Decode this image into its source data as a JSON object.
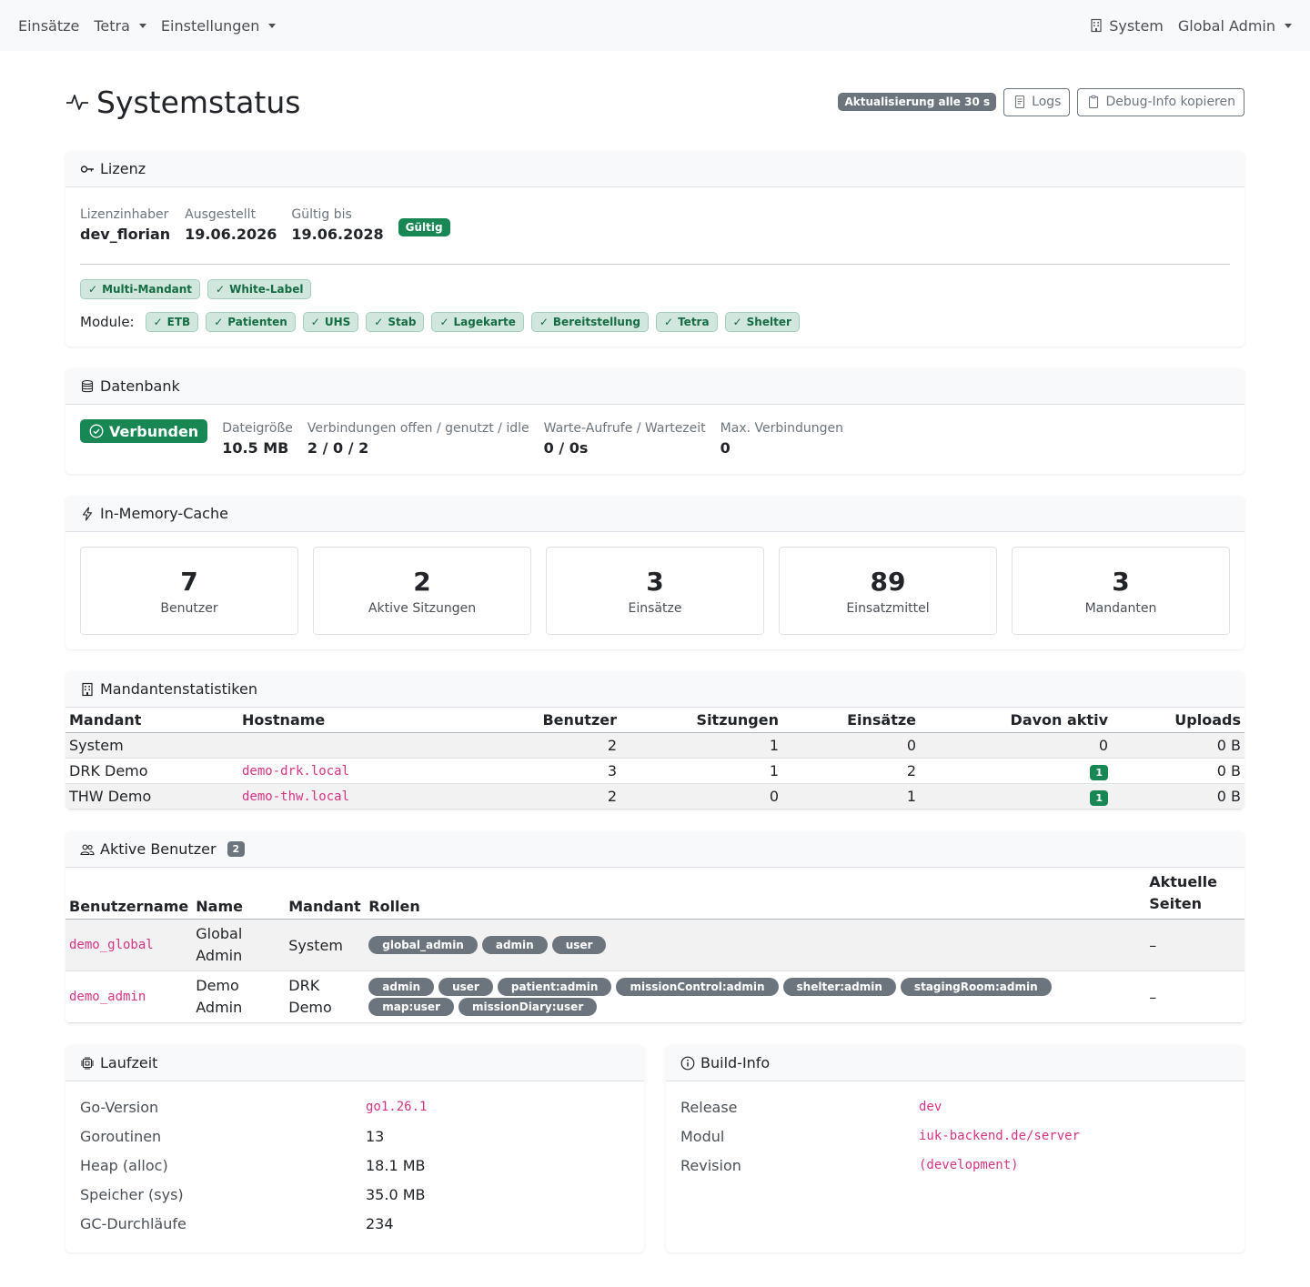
{
  "nav": {
    "left": [
      "Einsätze",
      "Tetra",
      "Einstellungen"
    ],
    "system": "System",
    "user": "Global Admin"
  },
  "header": {
    "title": "Systemstatus",
    "refresh_badge": "Aktualisierung alle 30 s",
    "logs_button": "Logs",
    "debug_button": "Debug-Info kopieren"
  },
  "license": {
    "title": "Lizenz",
    "holder_label": "Lizenzinhaber",
    "holder": "dev_florian",
    "issued_label": "Ausgestellt",
    "issued": "19.06.2026",
    "valid_label": "Gültig bis",
    "valid": "19.06.2028",
    "status": "Gültig",
    "features": [
      "Multi-Mandant",
      "White-Label"
    ],
    "modules_label": "Module:",
    "modules": [
      "ETB",
      "Patienten",
      "UHS",
      "Stab",
      "Lagekarte",
      "Bereitstellung",
      "Tetra",
      "Shelter"
    ]
  },
  "database": {
    "title": "Datenbank",
    "status": "Verbunden",
    "size_label": "Dateigröße",
    "size": "10.5 MB",
    "conn_label": "Verbindungen offen / genutzt / idle",
    "conn": "2 / 0 / 2",
    "wait_label": "Warte-Aufrufe / Wartezeit",
    "wait": "0 / 0s",
    "max_label": "Max. Verbindungen",
    "max": "0"
  },
  "cache": {
    "title": "In-Memory-Cache",
    "stats": [
      {
        "value": "7",
        "label": "Benutzer"
      },
      {
        "value": "2",
        "label": "Aktive Sitzungen"
      },
      {
        "value": "3",
        "label": "Einsätze"
      },
      {
        "value": "89",
        "label": "Einsatzmittel"
      },
      {
        "value": "3",
        "label": "Mandanten"
      }
    ]
  },
  "tenants": {
    "title": "Mandantenstatistiken",
    "columns": [
      "Mandant",
      "Hostname",
      "Benutzer",
      "Sitzungen",
      "Einsätze",
      "Davon aktiv",
      "Uploads"
    ],
    "rows": [
      {
        "mandant": "System",
        "hostname": "",
        "benutzer": "2",
        "sitzungen": "1",
        "einsaetze": "0",
        "aktiv": "0",
        "uploads": "0 B"
      },
      {
        "mandant": "DRK Demo",
        "hostname": "demo-drk.local",
        "benutzer": "3",
        "sitzungen": "1",
        "einsaetze": "2",
        "aktiv": "1",
        "uploads": "0 B"
      },
      {
        "mandant": "THW Demo",
        "hostname": "demo-thw.local",
        "benutzer": "2",
        "sitzungen": "0",
        "einsaetze": "1",
        "aktiv": "1",
        "uploads": "0 B"
      }
    ]
  },
  "active_users": {
    "title": "Aktive Benutzer",
    "count": "2",
    "columns": [
      "Benutzername",
      "Name",
      "Mandant",
      "Rollen",
      "Aktuelle Seiten"
    ],
    "rows": [
      {
        "username": "demo_global",
        "name": "Global Admin",
        "mandant": "System",
        "roles": [
          "global_admin",
          "admin",
          "user"
        ],
        "pages": "–"
      },
      {
        "username": "demo_admin",
        "name": "Demo Admin",
        "mandant": "DRK Demo",
        "roles": [
          "admin",
          "user",
          "patient:admin",
          "missionControl:admin",
          "shelter:admin",
          "stagingRoom:admin",
          "map:user",
          "missionDiary:user"
        ],
        "pages": "–"
      }
    ]
  },
  "runtime": {
    "title": "Laufzeit",
    "rows": [
      {
        "k": "Go-Version",
        "v": "go1.26.1",
        "mono": true
      },
      {
        "k": "Goroutinen",
        "v": "13"
      },
      {
        "k": "Heap (alloc)",
        "v": "18.1 MB"
      },
      {
        "k": "Speicher (sys)",
        "v": "35.0 MB"
      },
      {
        "k": "GC-Durchläufe",
        "v": "234"
      }
    ]
  },
  "build": {
    "title": "Build-Info",
    "rows": [
      {
        "k": "Release",
        "v": "dev",
        "mono": true
      },
      {
        "k": "Modul",
        "v": "iuk-backend.de/server",
        "mono": true
      },
      {
        "k": "Revision",
        "v": "(development)",
        "mono": true
      }
    ]
  }
}
